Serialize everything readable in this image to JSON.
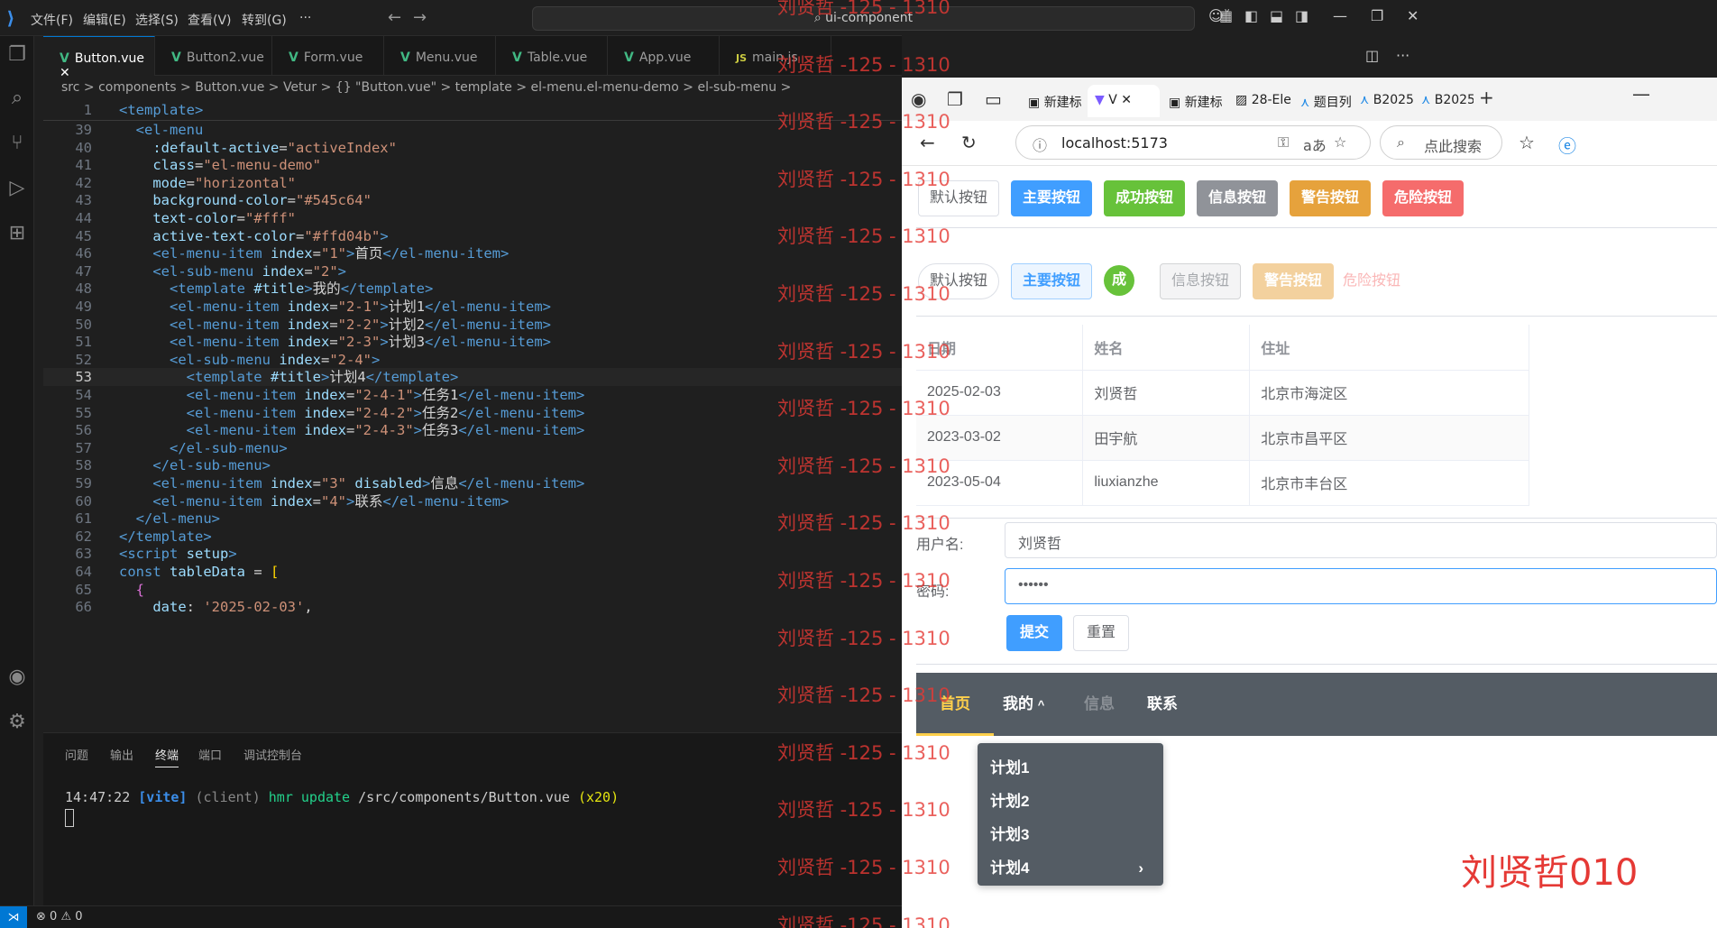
{
  "vscode": {
    "menus": [
      "文件(F)",
      "编辑(E)",
      "选择(S)",
      "查看(V)",
      "转到(G)",
      "···"
    ],
    "search_text": "ui-component",
    "tabs": [
      {
        "label": "Button.vue",
        "active": true,
        "icon": "vue-icon"
      },
      {
        "label": "Button2.vue",
        "active": false,
        "icon": "vue-icon"
      },
      {
        "label": "Form.vue",
        "active": false,
        "icon": "vue-icon"
      },
      {
        "label": "Menu.vue",
        "active": false,
        "icon": "vue-icon"
      },
      {
        "label": "Table.vue",
        "active": false,
        "icon": "vue-icon"
      },
      {
        "label": "App.vue",
        "active": false,
        "icon": "vue-icon"
      },
      {
        "label": "main.js",
        "active": false,
        "icon": "js-icon"
      }
    ],
    "js_badge": "JS",
    "breadcrumb": "src > components > Button.vue > Vetur > {} \"Button.vue\" > template > el-menu.el-menu-demo > el-sub-menu >",
    "sticky_line": {
      "num": "1",
      "text": "<template>"
    },
    "code_lines": [
      {
        "num": "39",
        "indent": "  ",
        "parts": [
          [
            "t-tag",
            "<el-menu"
          ]
        ]
      },
      {
        "num": "40",
        "indent": "    ",
        "parts": [
          [
            "t-attr",
            ":default-active"
          ],
          [
            "t-txt",
            "="
          ],
          [
            "t-str",
            "\"activeIndex\""
          ]
        ]
      },
      {
        "num": "41",
        "indent": "    ",
        "parts": [
          [
            "t-attr",
            "class"
          ],
          [
            "t-txt",
            "="
          ],
          [
            "t-str",
            "\"el-menu-demo\""
          ]
        ]
      },
      {
        "num": "42",
        "indent": "    ",
        "parts": [
          [
            "t-attr",
            "mode"
          ],
          [
            "t-txt",
            "="
          ],
          [
            "t-str",
            "\"horizontal\""
          ]
        ]
      },
      {
        "num": "43",
        "indent": "    ",
        "parts": [
          [
            "t-attr",
            "background-color"
          ],
          [
            "t-txt",
            "="
          ],
          [
            "t-str",
            "\"#545c64\""
          ]
        ]
      },
      {
        "num": "44",
        "indent": "    ",
        "parts": [
          [
            "t-attr",
            "text-color"
          ],
          [
            "t-txt",
            "="
          ],
          [
            "t-str",
            "\"#fff\""
          ]
        ]
      },
      {
        "num": "45",
        "indent": "    ",
        "parts": [
          [
            "t-attr",
            "active-text-color"
          ],
          [
            "t-txt",
            "="
          ],
          [
            "t-str",
            "\"#ffd04b\""
          ],
          [
            "t-tag",
            ">"
          ]
        ]
      },
      {
        "num": "46",
        "indent": "    ",
        "parts": [
          [
            "t-tag",
            "<el-menu-item "
          ],
          [
            "t-attr",
            "index"
          ],
          [
            "t-txt",
            "="
          ],
          [
            "t-str",
            "\"1\""
          ],
          [
            "t-tag",
            ">"
          ],
          [
            "t-txt",
            "首页"
          ],
          [
            "t-tag",
            "</el-menu-item>"
          ]
        ]
      },
      {
        "num": "47",
        "indent": "    ",
        "parts": [
          [
            "t-tag",
            "<el-sub-menu "
          ],
          [
            "t-attr",
            "index"
          ],
          [
            "t-txt",
            "="
          ],
          [
            "t-str",
            "\"2\""
          ],
          [
            "t-tag",
            ">"
          ]
        ]
      },
      {
        "num": "48",
        "indent": "      ",
        "parts": [
          [
            "t-tag",
            "<template "
          ],
          [
            "t-attr",
            "#title"
          ],
          [
            "t-tag",
            ">"
          ],
          [
            "t-txt",
            "我的"
          ],
          [
            "t-tag",
            "</template>"
          ]
        ]
      },
      {
        "num": "49",
        "indent": "      ",
        "parts": [
          [
            "t-tag",
            "<el-menu-item "
          ],
          [
            "t-attr",
            "index"
          ],
          [
            "t-txt",
            "="
          ],
          [
            "t-str",
            "\"2-1\""
          ],
          [
            "t-tag",
            ">"
          ],
          [
            "t-txt",
            "计划1"
          ],
          [
            "t-tag",
            "</el-menu-item>"
          ]
        ]
      },
      {
        "num": "50",
        "indent": "      ",
        "parts": [
          [
            "t-tag",
            "<el-menu-item "
          ],
          [
            "t-attr",
            "index"
          ],
          [
            "t-txt",
            "="
          ],
          [
            "t-str",
            "\"2-2\""
          ],
          [
            "t-tag",
            ">"
          ],
          [
            "t-txt",
            "计划2"
          ],
          [
            "t-tag",
            "</el-menu-item>"
          ]
        ]
      },
      {
        "num": "51",
        "indent": "      ",
        "parts": [
          [
            "t-tag",
            "<el-menu-item "
          ],
          [
            "t-attr",
            "index"
          ],
          [
            "t-txt",
            "="
          ],
          [
            "t-str",
            "\"2-3\""
          ],
          [
            "t-tag",
            ">"
          ],
          [
            "t-txt",
            "计划3"
          ],
          [
            "t-tag",
            "</el-menu-item>"
          ]
        ]
      },
      {
        "num": "52",
        "indent": "      ",
        "parts": [
          [
            "t-tag",
            "<el-sub-menu "
          ],
          [
            "t-attr",
            "index"
          ],
          [
            "t-txt",
            "="
          ],
          [
            "t-str",
            "\"2-4\""
          ],
          [
            "t-tag",
            ">"
          ]
        ]
      },
      {
        "num": "53",
        "indent": "        ",
        "current": true,
        "parts": [
          [
            "t-tag",
            "<template "
          ],
          [
            "t-attr",
            "#title"
          ],
          [
            "t-tag",
            ">"
          ],
          [
            "t-txt",
            "计划4"
          ],
          [
            "t-tag",
            "</template>"
          ]
        ]
      },
      {
        "num": "54",
        "indent": "        ",
        "parts": [
          [
            "t-tag",
            "<el-menu-item "
          ],
          [
            "t-attr",
            "index"
          ],
          [
            "t-txt",
            "="
          ],
          [
            "t-str",
            "\"2-4-1\""
          ],
          [
            "t-tag",
            ">"
          ],
          [
            "t-txt",
            "任务1"
          ],
          [
            "t-tag",
            "</el-menu-item>"
          ]
        ]
      },
      {
        "num": "55",
        "indent": "        ",
        "parts": [
          [
            "t-tag",
            "<el-menu-item "
          ],
          [
            "t-attr",
            "index"
          ],
          [
            "t-txt",
            "="
          ],
          [
            "t-str",
            "\"2-4-2\""
          ],
          [
            "t-tag",
            ">"
          ],
          [
            "t-txt",
            "任务2"
          ],
          [
            "t-tag",
            "</el-menu-item>"
          ]
        ]
      },
      {
        "num": "56",
        "indent": "        ",
        "parts": [
          [
            "t-tag",
            "<el-menu-item "
          ],
          [
            "t-attr",
            "index"
          ],
          [
            "t-txt",
            "="
          ],
          [
            "t-str",
            "\"2-4-3\""
          ],
          [
            "t-tag",
            ">"
          ],
          [
            "t-txt",
            "任务3"
          ],
          [
            "t-tag",
            "</el-menu-item>"
          ]
        ]
      },
      {
        "num": "57",
        "indent": "      ",
        "parts": [
          [
            "t-tag",
            "</el-sub-menu>"
          ]
        ]
      },
      {
        "num": "58",
        "indent": "    ",
        "parts": [
          [
            "t-tag",
            "</el-sub-menu>"
          ]
        ]
      },
      {
        "num": "59",
        "indent": "    ",
        "parts": [
          [
            "t-tag",
            "<el-menu-item "
          ],
          [
            "t-attr",
            "index"
          ],
          [
            "t-txt",
            "="
          ],
          [
            "t-str",
            "\"3\" "
          ],
          [
            "t-attr",
            "disabled"
          ],
          [
            "t-tag",
            ">"
          ],
          [
            "t-txt",
            "信息"
          ],
          [
            "t-tag",
            "</el-menu-item>"
          ]
        ]
      },
      {
        "num": "60",
        "indent": "    ",
        "parts": [
          [
            "t-tag",
            "<el-menu-item "
          ],
          [
            "t-attr",
            "index"
          ],
          [
            "t-txt",
            "="
          ],
          [
            "t-str",
            "\"4\""
          ],
          [
            "t-tag",
            ">"
          ],
          [
            "t-txt",
            "联系"
          ],
          [
            "t-tag",
            "</el-menu-item>"
          ]
        ]
      },
      {
        "num": "61",
        "indent": "  ",
        "parts": [
          [
            "t-tag",
            "</el-menu>"
          ]
        ]
      },
      {
        "num": "62",
        "indent": "",
        "parts": [
          [
            "t-tag",
            "</template>"
          ]
        ]
      },
      {
        "num": "63",
        "indent": "",
        "parts": [
          [
            "t-tag",
            "<script "
          ],
          [
            "t-attr",
            "setup"
          ],
          [
            "t-tag",
            ">"
          ]
        ]
      },
      {
        "num": "64",
        "indent": "",
        "parts": [
          [
            "t-kw",
            "const "
          ],
          [
            "t-attr",
            "tableData"
          ],
          [
            "t-txt",
            " = "
          ],
          [
            "t-yel",
            "["
          ]
        ]
      },
      {
        "num": "65",
        "indent": "  ",
        "parts": [
          [
            "t-pur",
            "{"
          ]
        ]
      },
      {
        "num": "66",
        "indent": "    ",
        "parts": [
          [
            "t-attr",
            "date"
          ],
          [
            "t-txt",
            ": "
          ],
          [
            "t-str",
            "'2025-02-03'"
          ],
          [
            "t-txt",
            ","
          ]
        ]
      }
    ],
    "panel_tabs": [
      "问题",
      "输出",
      "终端",
      "端口",
      "调试控制台"
    ],
    "panel_active": "终端",
    "terminal": {
      "time": "14:47:22",
      "tag": "[vite]",
      "client": "(client)",
      "msg": "hmr update",
      "path": "/src/components/Button.vue",
      "count": "(x20)"
    },
    "status": {
      "errors": "0",
      "warnings": "0"
    }
  },
  "browser": {
    "tabs": [
      "新建标",
      "V",
      "新建标",
      "28-Ele",
      "题目列",
      "B2025",
      "B2025"
    ],
    "new_tab": "+",
    "url": "localhost:5173",
    "search_placeholder": "点此搜索",
    "buttons_row1": [
      {
        "label": "默认按钮",
        "type": "default"
      },
      {
        "label": "主要按钮",
        "type": "primary"
      },
      {
        "label": "成功按钮",
        "type": "success"
      },
      {
        "label": "信息按钮",
        "type": "info"
      },
      {
        "label": "警告按钮",
        "type": "warning"
      },
      {
        "label": "危险按钮",
        "type": "danger"
      }
    ],
    "buttons_row2": [
      {
        "label": "默认按钮",
        "type": "default-round"
      },
      {
        "label": "主要按钮",
        "type": "primary-plain"
      },
      {
        "label": "成",
        "type": "success-circle"
      },
      {
        "label": "信息按钮",
        "type": "info-disabled"
      },
      {
        "label": "警告按钮",
        "type": "warning-disabled"
      },
      {
        "label": "危险按钮",
        "type": "danger-text"
      }
    ],
    "table": {
      "headers": [
        "日期",
        "姓名",
        "住址"
      ],
      "rows": [
        [
          "2025-02-03",
          "刘贤哲",
          "北京市海淀区"
        ],
        [
          "2023-03-02",
          "田宇航",
          "北京市昌平区"
        ],
        [
          "2023-05-04",
          "liuxianzhe",
          "北京市丰台区"
        ]
      ]
    },
    "form": {
      "username_label": "用户名:",
      "username_value": "刘贤哲",
      "password_label": "密码:",
      "password_value": "••••••",
      "submit": "提交",
      "reset": "重置"
    },
    "menu": {
      "items": [
        {
          "label": "首页",
          "state": "active"
        },
        {
          "label": "我的",
          "state": "open"
        },
        {
          "label": "信息",
          "state": "disabled"
        },
        {
          "label": "联系",
          "state": "normal"
        }
      ],
      "submenu": [
        "计划1",
        "计划2",
        "计划3",
        "计划4"
      ],
      "submenu_arrow": "›",
      "open_arrow": "^"
    },
    "signature": "刘贤哲010"
  },
  "watermark": "刘贤哲 -125 - 1310",
  "colors": {
    "primary": "#409eff",
    "success": "#67c23a",
    "info": "#909399",
    "warning": "#e6a23c",
    "danger": "#f56c6c",
    "menu_bg": "#545c64",
    "menu_active": "#ffd04b"
  }
}
